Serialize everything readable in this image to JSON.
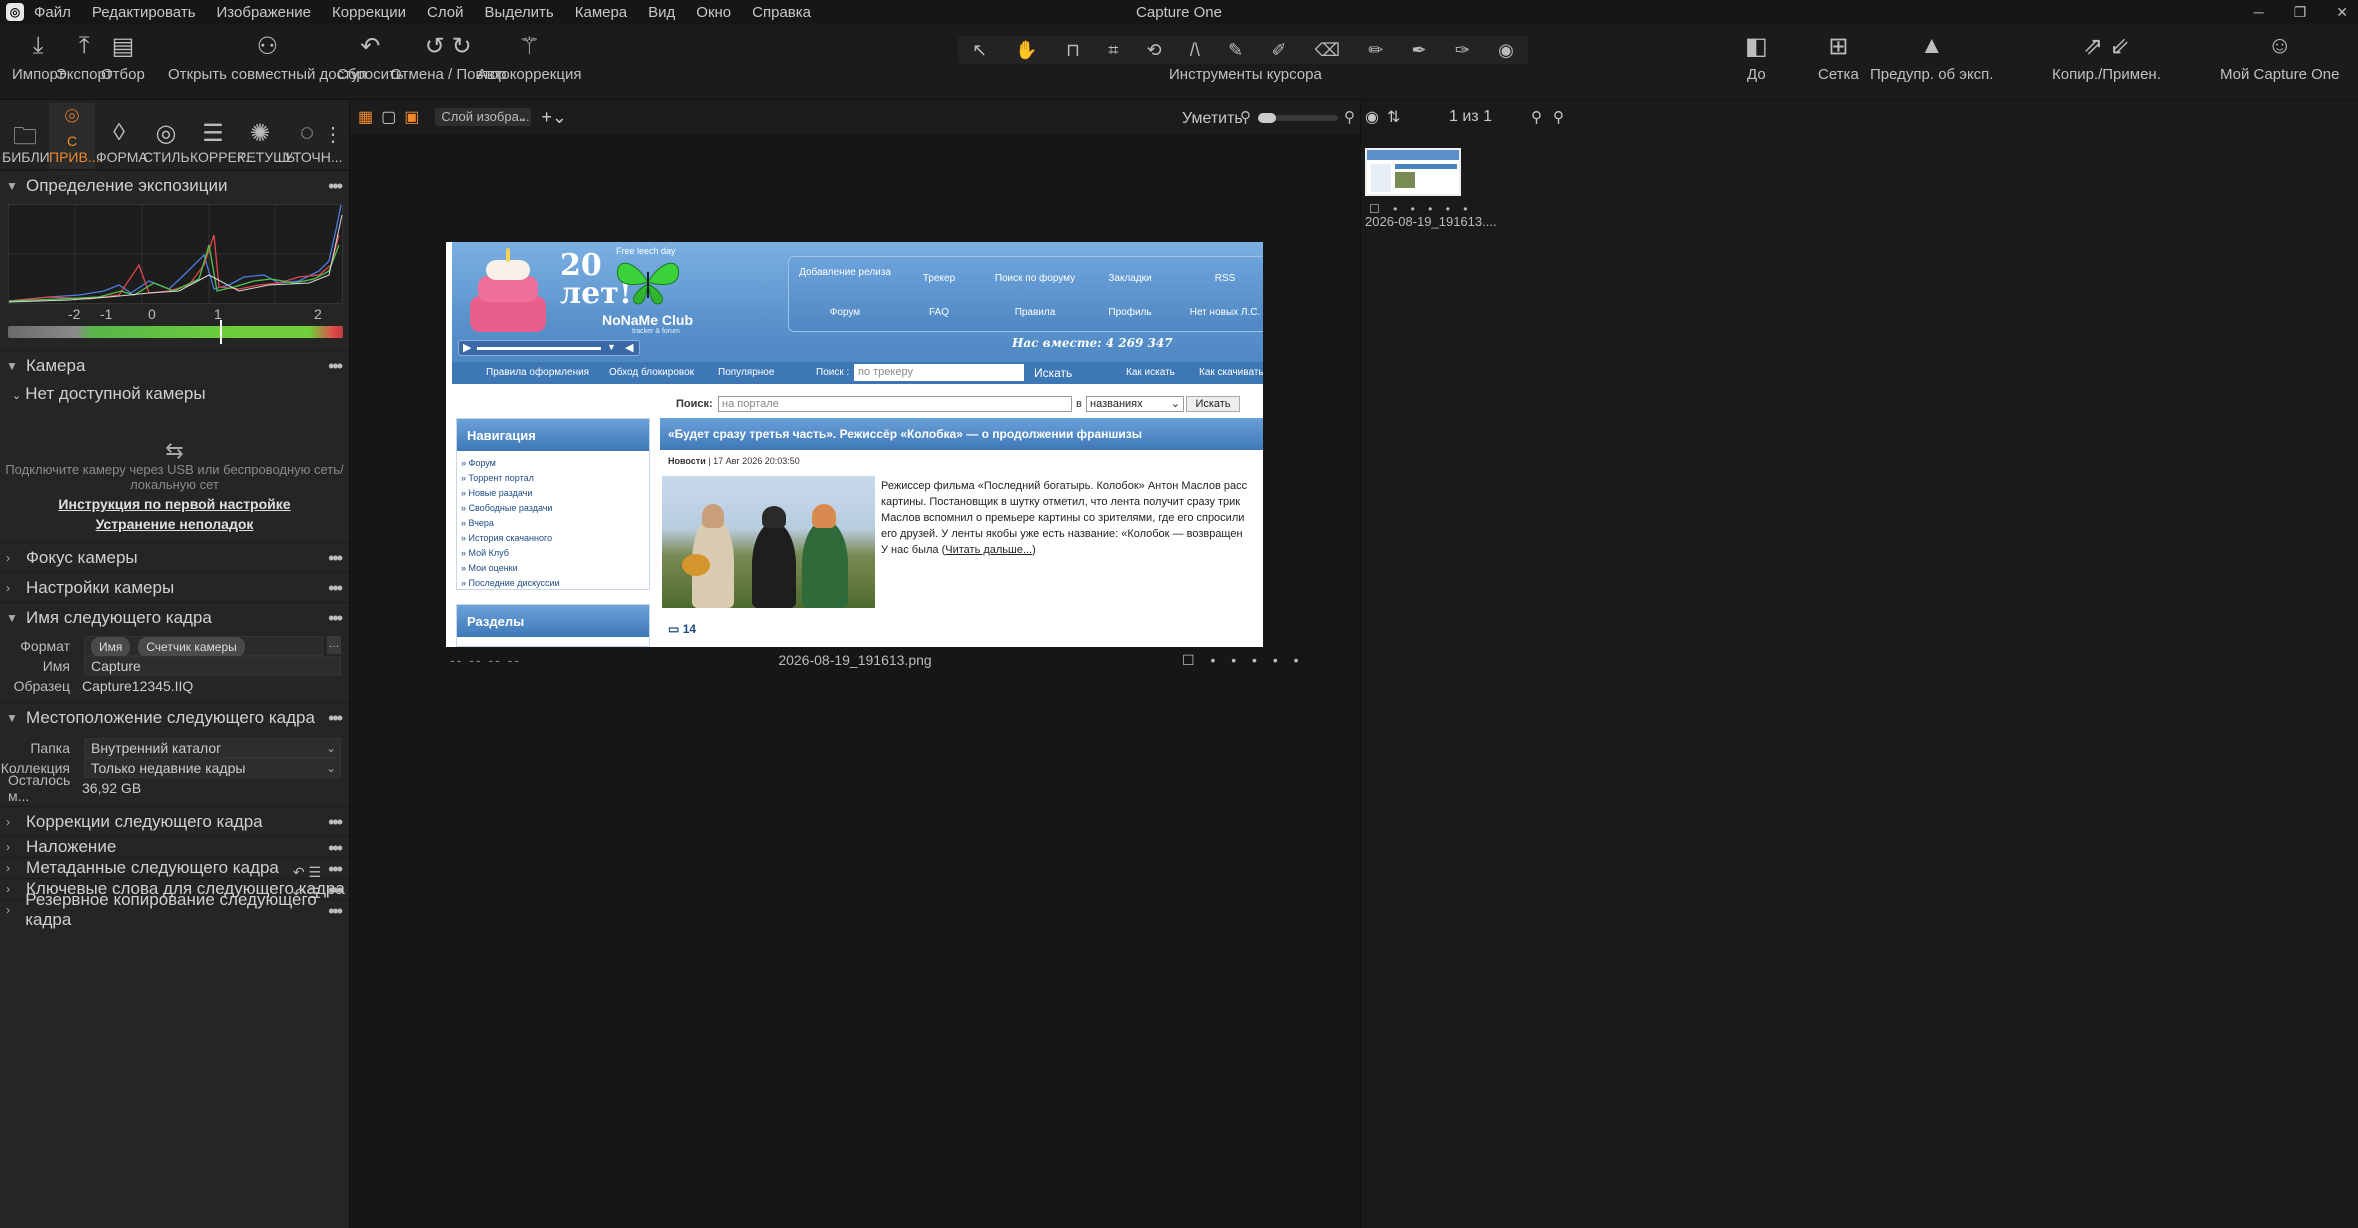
{
  "app": {
    "title": "Capture One",
    "menu": [
      "Файл",
      "Редактировать",
      "Изображение",
      "Коррекции",
      "Слой",
      "Выделить",
      "Камера",
      "Вид",
      "Окно",
      "Справка"
    ]
  },
  "toolbar": {
    "import": "Импорт",
    "export": "Экспорт",
    "select": "Отбор",
    "share": "Открыть совместный доступ",
    "reset": "Сбросить",
    "undo_redo": "Отмена / Повтор",
    "autocorrect": "Автокоррекция",
    "cursor_tools": "Инструменты курсора",
    "before": "До",
    "grid": "Сетка",
    "exposure_warning": "Предупр. об эксп.",
    "copy_apply": "Копир./Примен.",
    "my_capture_one": "Мой Capture One"
  },
  "tool_tabs": [
    {
      "label": "БИБЛИ...",
      "icon": "folder-icon",
      "active": false
    },
    {
      "label": "С ПРИВ...",
      "icon": "camera-icon",
      "active": true
    },
    {
      "label": "ФОРМА",
      "icon": "lens-icon",
      "active": false
    },
    {
      "label": "СТИЛЬ",
      "icon": "style-icon",
      "active": false
    },
    {
      "label": "КОРРЕК...",
      "icon": "sliders-icon",
      "active": false
    },
    {
      "label": "РЕТУШЬ",
      "icon": "retouch-icon",
      "active": false
    },
    {
      "label": "УТОЧН...",
      "icon": "refine-icon",
      "active": false
    }
  ],
  "exposure": {
    "title": "Определение экспозиции",
    "ticks": [
      "-2",
      "-1",
      "0",
      "1",
      "2"
    ]
  },
  "camera": {
    "title": "Камера",
    "no_camera": "Нет доступной камеры",
    "hint": "Подключите камеру через USB или беспроводную сеть/локальную сет",
    "link_setup": "Инструкция по первой настройке",
    "link_trouble": "Устранение неполадок"
  },
  "sections_collapsed_1": [
    "Фокус камеры",
    "Настройки камеры"
  ],
  "next_name": {
    "title": "Имя следующего кадра",
    "format_label": "Формат",
    "format_tokens": [
      "Имя",
      "Счетчик камеры"
    ],
    "name_label": "Имя",
    "name_value": "Capture",
    "sample_label": "Образец",
    "sample_value": "Capture12345.IIQ"
  },
  "next_location": {
    "title": "Местоположение следующего кадра",
    "folder_label": "Папка",
    "folder_value": "Внутренний каталог",
    "collection_label": "Коллекция",
    "collection_value": "Только недавние кадры",
    "remaining_label": "Осталось м...",
    "remaining_value": "36,92 GB"
  },
  "sections_collapsed_2": [
    "Коррекции следующего кадра",
    "Наложение",
    "Метаданные следующего кадра",
    "Ключевые слова для следующего кадра",
    "Резервное копирование следующего кадра"
  ],
  "viewer": {
    "layer_select": "Слой изобра...",
    "fit": "Уметить",
    "footer_left": "-- -- -- --",
    "filename": "2026-08-19_191613.png"
  },
  "browser": {
    "count": "1 из 1",
    "thumb_name": "2026-08-19_191613...."
  },
  "webpage": {
    "free_leech": "Free leech day",
    "anniv": "20\nлет!",
    "logo": "NoNaMe Club",
    "logo_sub": "tracker & forum",
    "nav_top": [
      "Добавление релиза",
      "Трекер",
      "Поиск по форуму",
      "Закладки",
      "RSS"
    ],
    "nav_bottom": [
      "Форум",
      "FAQ",
      "Правила",
      "Профиль",
      "Нет новых Л.С."
    ],
    "online": "Нас вместе: 4 269 347",
    "subnav": [
      "Правила оформления",
      "Обход блокировок",
      "Популярное"
    ],
    "search_label": "Поиск :",
    "search_placeholder": "по трекеру",
    "search_btn": "Искать",
    "how_search": "Как искать",
    "how_download": "Как скачивать",
    "portal_search_label": "Поиск:",
    "portal_placeholder": "на портале",
    "portal_in": "в",
    "portal_select": "названиях",
    "portal_btn": "Искать",
    "nav_title": "Навигация",
    "nav_items": [
      "» Форум",
      "» Торрент портал",
      "» Новые раздачи",
      "» Свободные раздачи",
      "» Вчера",
      "» История скачанного",
      "» Мой Клуб",
      "» Мои оценки",
      "» Последние дискуссии"
    ],
    "sections_title": "Разделы",
    "article_title": "«Будет сразу третья часть». Режиссёр «Колобка» — о продолжении франшизы",
    "article_cat": "Новости",
    "article_date": "| 17 Авг 2026 20:03:50",
    "article_lines": [
      "Режиссер фильма «Последний богатырь. Колобок» Антон Маслов расс",
      "картины. Постановщик в шутку отметил, что лента получит сразу трик",
      "Маслов вспомнил о премьере картины со зрителями, где его спросили",
      "его друзей. У ленты якобы уже есть название: «Колобок — возвращен"
    ],
    "article_last_prefix": "У нас была (",
    "read_more": "Читать дальше...",
    "article_last_suffix": ")",
    "comments": "14"
  }
}
